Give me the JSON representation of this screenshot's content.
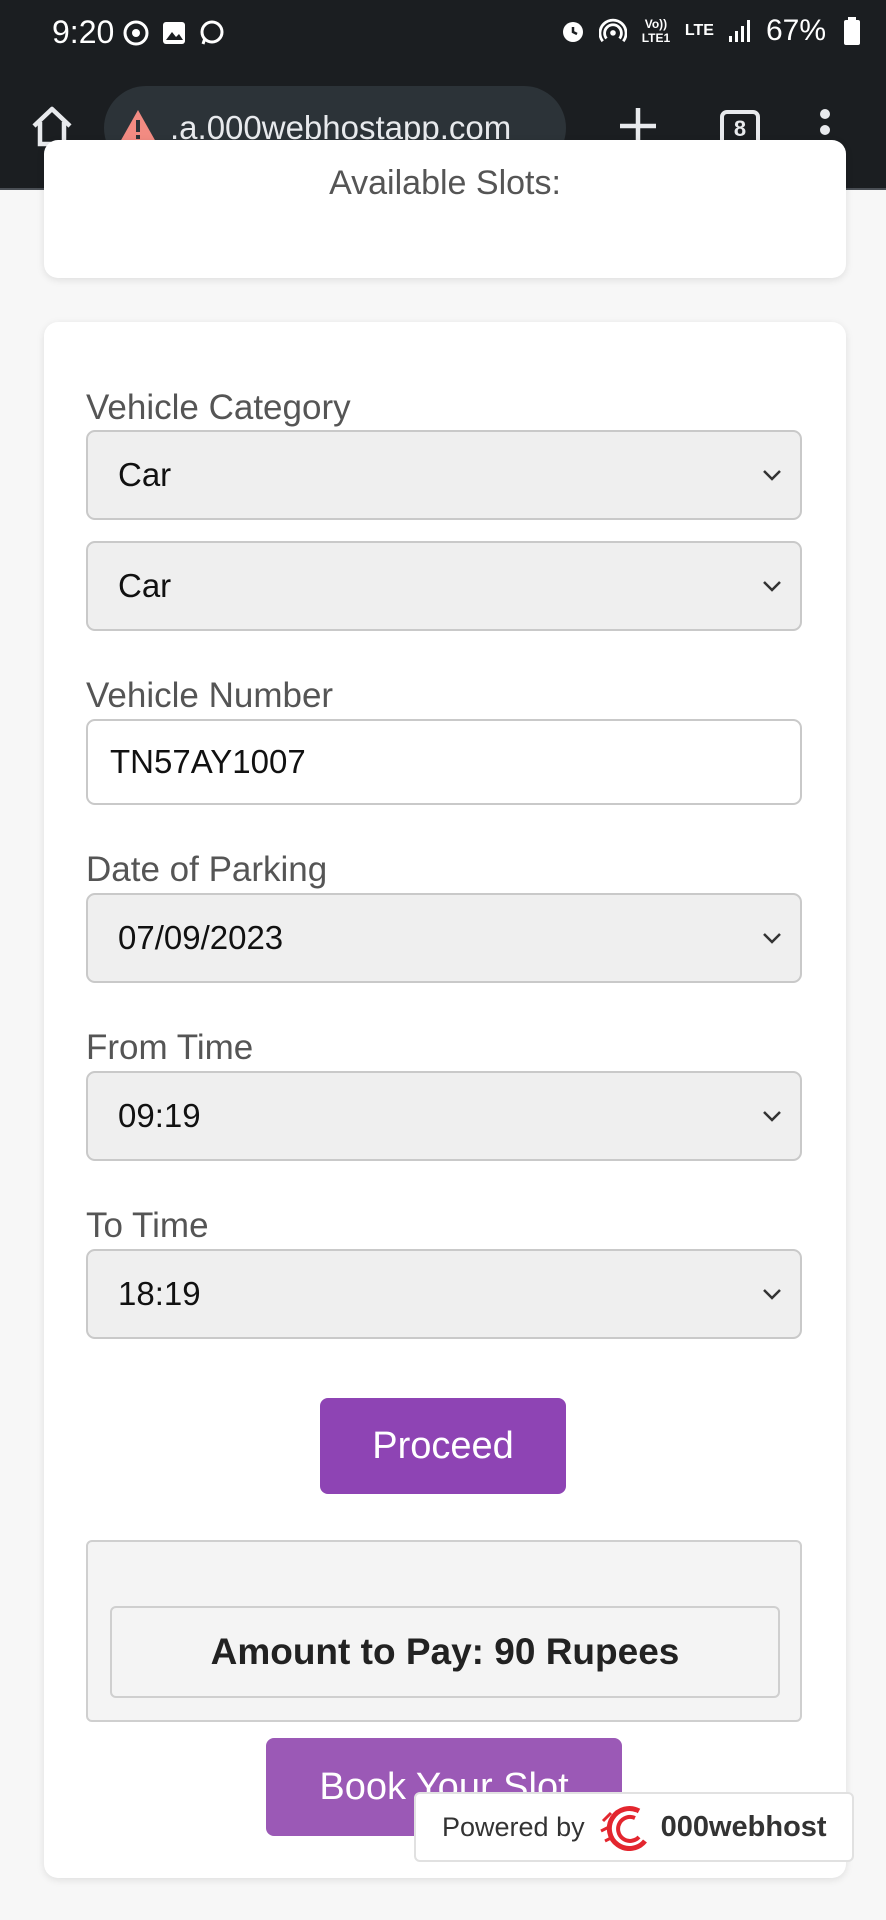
{
  "status_bar": {
    "time": "9:20",
    "network": "Vo)) LTE1",
    "lte": "LTE",
    "battery": "67%"
  },
  "browser": {
    "url": ".a.000webhostapp.com",
    "tab_count": "8"
  },
  "top_card": {
    "heading": "Available Slots:"
  },
  "form": {
    "vehicle_category_label": "Vehicle Category",
    "vehicle_category_value": "Car",
    "vehicle_type_value": "Car",
    "vehicle_number_label": "Vehicle Number",
    "vehicle_number_value": "TN57AY1007",
    "date_label": "Date of Parking",
    "date_value": "07/09/2023",
    "from_time_label": "From Time",
    "from_time_value": "09:19",
    "to_time_label": "To Time",
    "to_time_value": "18:19",
    "proceed_label": "Proceed",
    "amount_text": "Amount to Pay: 90 Rupees",
    "book_label": "Book Your Slot"
  },
  "footer": {
    "powered_by": "Powered by",
    "brand": "000webhost"
  },
  "colors": {
    "primary_purple": "#8e44b4",
    "secondary_purple": "#9b59b6",
    "warning_red": "#f28b82"
  }
}
